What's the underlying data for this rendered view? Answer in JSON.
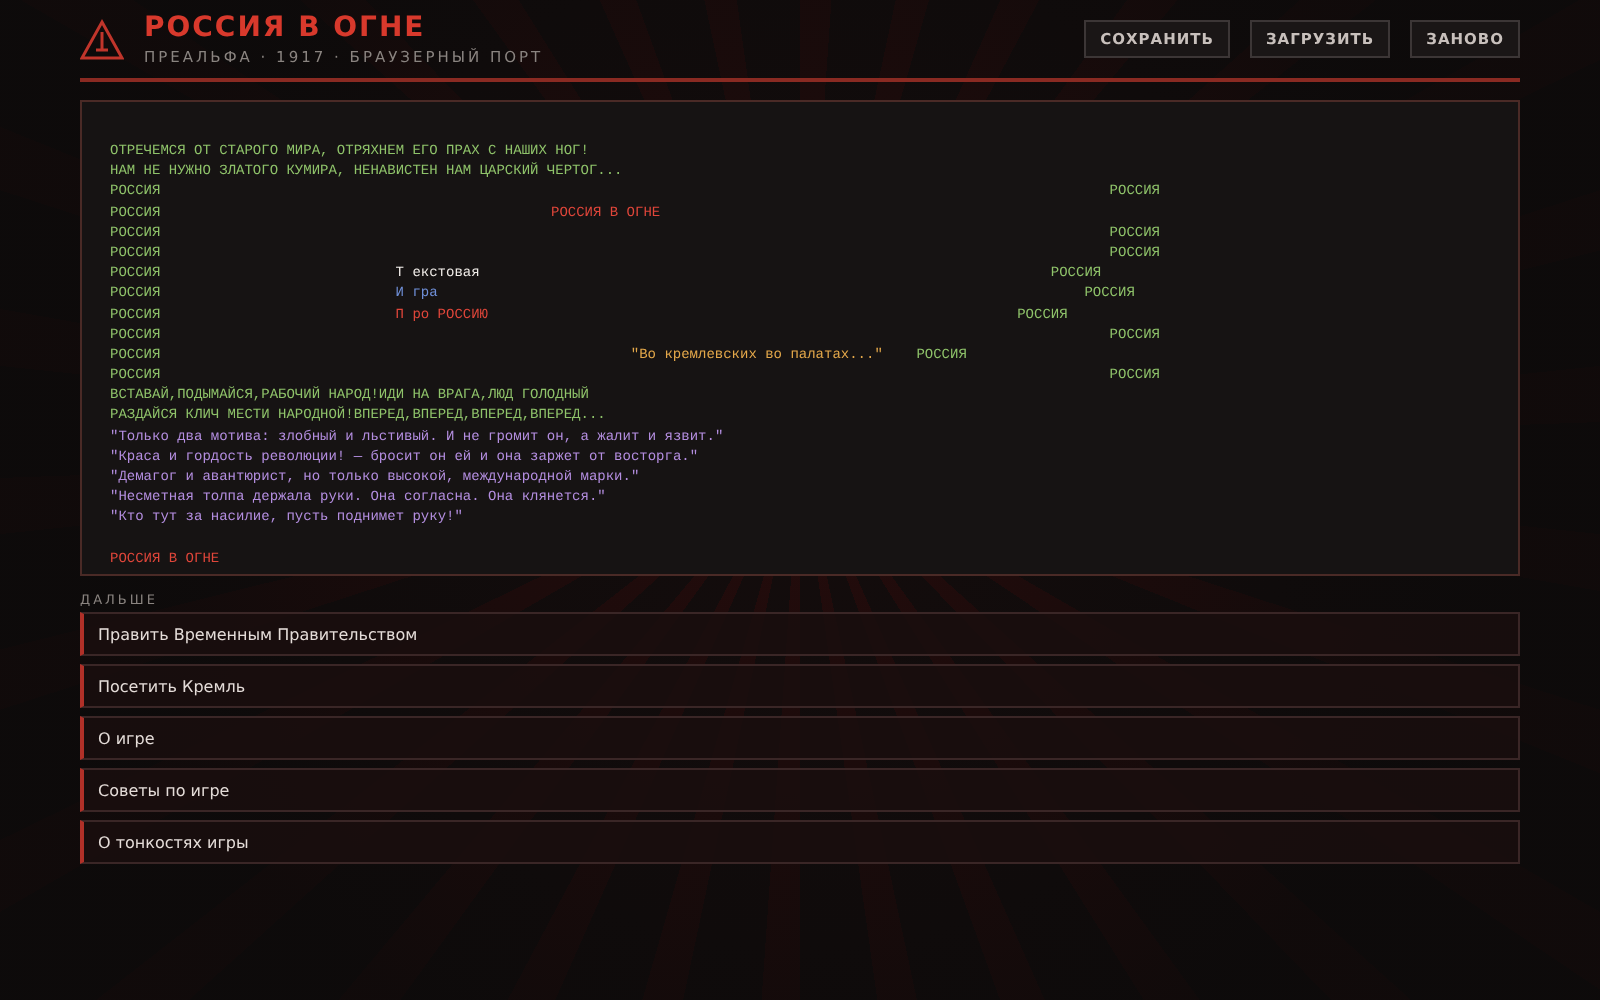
{
  "header": {
    "title": "РОССИЯ В ОГНЕ",
    "subtitle": "ПРЕАЛЬФА · 1917 · БРАУЗЕРНЫЙ ПОРТ"
  },
  "buttons": [
    "СОХРАНИТЬ",
    "ЗАГРУЗИТЬ",
    "ЗАНОВО"
  ],
  "terminal": {
    "lines": [
      {
        "segments": [
          {
            "text": "ОТРЕЧЕМСЯ ОТ СТАРОГО МИРА, ОТРЯХНЕМ ЕГО ПРАХ С НАШИХ НОГ!",
            "color": "#8fc36a"
          }
        ]
      },
      {
        "segments": [
          {
            "text": "НАМ НЕ НУЖНО ЗЛАТОГО КУМИРА, НЕНАВИСТЕН НАМ ЦАРСКИЙ ЧЕРТОГ...",
            "color": "#8fc36a"
          }
        ]
      },
      {
        "segments": [
          {
            "text": "РОССИЯ",
            "color": "#8fc36a"
          },
          {
            "text": "РОССИЯ",
            "color": "#8fc36a"
          }
        ]
      },
      {
        "segments": [
          {
            "text": "РОССИЯ",
            "color": "#8fc36a"
          },
          {
            "text": "РОССИЯ В ОГНЕ",
            "color": "#e0463a"
          }
        ]
      },
      {
        "segments": [
          {
            "text": "РОССИЯ",
            "color": "#8fc36a"
          },
          {
            "text": "РОССИЯ",
            "color": "#8fc36a"
          }
        ]
      },
      {
        "segments": [
          {
            "text": "РОССИЯ",
            "color": "#8fc36a"
          },
          {
            "text": "РОССИЯ",
            "color": "#8fc36a"
          }
        ]
      },
      {
        "segments": [
          {
            "text": "РОССИЯ",
            "color": "#8fc36a"
          },
          {
            "text": "Т екстовая",
            "color": "#f0ece8"
          },
          {
            "text": "РОССИЯ",
            "color": "#8fc36a"
          }
        ]
      },
      {
        "segments": [
          {
            "text": "РОССИЯ",
            "color": "#8fc36a"
          },
          {
            "text": "И гра",
            "color": "#6f8fd8"
          },
          {
            "text": "РОССИЯ",
            "color": "#8fc36a"
          }
        ]
      },
      {
        "segments": [
          {
            "text": "РОССИЯ",
            "color": "#8fc36a"
          },
          {
            "text": "П ро РОССИЮ",
            "color": "#e0463a"
          },
          {
            "text": "РОССИЯ",
            "color": "#8fc36a"
          }
        ]
      },
      {
        "segments": [
          {
            "text": "РОССИЯ",
            "color": "#8fc36a"
          },
          {
            "text": "РОССИЯ",
            "color": "#8fc36a"
          }
        ]
      },
      {
        "segments": [
          {
            "text": "РОССИЯ",
            "color": "#8fc36a"
          },
          {
            "text": "\"Во кремлевских во палатах...\"",
            "color": "#e4a84a"
          },
          {
            "text": "РОССИЯ",
            "color": "#8fc36a"
          }
        ]
      },
      {
        "segments": [
          {
            "text": "РОССИЯ",
            "color": "#8fc36a"
          },
          {
            "text": "РОССИЯ",
            "color": "#8fc36a"
          }
        ]
      },
      {
        "segments": [
          {
            "text": "ВСТАВАЙ,ПОДЫМАЙСЯ,РАБОЧИЙ НАРОД!ИДИ НА ВРАГА,ЛЮД ГОЛОДНЫЙ",
            "color": "#8fc36a"
          }
        ]
      },
      {
        "segments": [
          {
            "text": "РАЗДАЙСЯ КЛИЧ МЕСТИ НАРОДНОЙ!ВПЕРЕД,ВПЕРЕД,ВПЕРЕД,ВПЕРЕД...",
            "color": "#8fc36a"
          }
        ]
      },
      {
        "segments": [
          {
            "text": "\"Только два мотива: злобный и льстивый. И не громит он, а жалит и язвит.\"",
            "color": "#b48ee0"
          }
        ]
      },
      {
        "segments": [
          {
            "text": "\"Краса и гордость революции! — бросит он ей и она заржет от восторга.\"",
            "color": "#b48ee0"
          }
        ]
      },
      {
        "segments": [
          {
            "text": "\"Демагог и авантюрист, но только высокой, международной марки.\"",
            "color": "#b48ee0"
          }
        ]
      },
      {
        "segments": [
          {
            "text": "\"Несметная толпа держала руки. Она согласна. Она клянется.\"",
            "color": "#b48ee0"
          }
        ]
      },
      {
        "segments": [
          {
            "text": "\"Кто тут за насилие, пусть поднимет руку!\"",
            "color": "#b48ee0"
          }
        ]
      },
      {
        "gap_before": true,
        "segments": [
          {
            "text": "РОССИЯ В ОГНЕ",
            "color": "#e0463a"
          }
        ]
      }
    ]
  },
  "next_label": "ДАЛЬШЕ",
  "choices": [
    "Править Временным Правительством",
    "Посетить Кремль",
    "О игре",
    "Советы по игре",
    "О тонкостях игры"
  ]
}
